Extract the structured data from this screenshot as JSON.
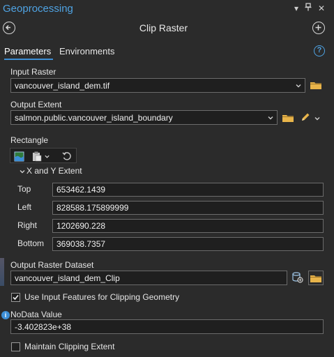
{
  "pane": {
    "title": "Geoprocessing"
  },
  "tool": {
    "title": "Clip Raster"
  },
  "tabs": [
    {
      "label": "Parameters"
    },
    {
      "label": "Environments"
    }
  ],
  "input_raster": {
    "label": "Input Raster",
    "value": "vancouver_island_dem.tif"
  },
  "output_extent": {
    "label": "Output Extent",
    "value": "salmon.public.vancouver_island_boundary"
  },
  "rectangle": {
    "label": "Rectangle"
  },
  "extent_section": {
    "label": "X and Y Extent"
  },
  "extent": {
    "top": {
      "label": "Top",
      "value": "653462.1439"
    },
    "left": {
      "label": "Left",
      "value": "828588.175899999"
    },
    "right": {
      "label": "Right",
      "value": "1202690.228"
    },
    "bottom": {
      "label": "Bottom",
      "value": "369038.7357"
    }
  },
  "output_raster": {
    "label": "Output Raster Dataset",
    "value": "vancouver_island_dem_Clip"
  },
  "use_input_features": {
    "label": "Use Input Features for Clipping Geometry",
    "checked": true
  },
  "nodata": {
    "label": "NoData Value",
    "value": "-3.402823e+38"
  },
  "maintain_extent": {
    "label": "Maintain Clipping Extent",
    "checked": false
  },
  "colors": {
    "accent": "#3d8fd6",
    "title": "#4fa3e3",
    "background": "#2b2b2b",
    "field_bg": "#1f1f1f",
    "folder": "#e8b44a"
  }
}
